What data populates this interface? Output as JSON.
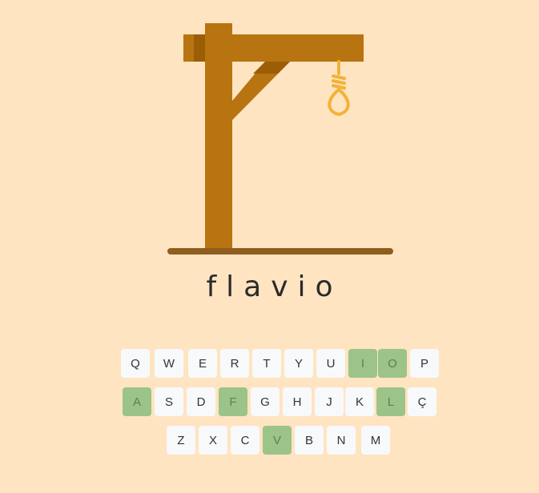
{
  "game": {
    "word": "flavio",
    "colors": {
      "background": "#ffe4c2",
      "wood": "#b87410",
      "wood_dark": "#9b5e06",
      "ground": "#8f5d1e",
      "rope": "#f3b237",
      "key_used": "#9cc388",
      "key_default": "#f8f9fa"
    }
  },
  "keyboard": {
    "rows": [
      [
        {
          "label": "Q",
          "used": false
        },
        {
          "label": "W",
          "used": false
        },
        {
          "label": "E",
          "used": false
        },
        {
          "label": "R",
          "used": false
        },
        {
          "label": "T",
          "used": false
        },
        {
          "label": "Y",
          "used": false
        },
        {
          "label": "U",
          "used": false
        },
        {
          "label": "I",
          "used": true
        },
        {
          "label": "O",
          "used": true
        },
        {
          "label": "P",
          "used": false
        }
      ],
      [
        {
          "label": "A",
          "used": true
        },
        {
          "label": "S",
          "used": false
        },
        {
          "label": "D",
          "used": false
        },
        {
          "label": "F",
          "used": true
        },
        {
          "label": "G",
          "used": false
        },
        {
          "label": "H",
          "used": false
        },
        {
          "label": "J",
          "used": false
        },
        {
          "label": "K",
          "used": false
        },
        {
          "label": "L",
          "used": true
        },
        {
          "label": "Ç",
          "used": false
        }
      ],
      [
        {
          "label": "Z",
          "used": false
        },
        {
          "label": "X",
          "used": false
        },
        {
          "label": "C",
          "used": false
        },
        {
          "label": "V",
          "used": true
        },
        {
          "label": "B",
          "used": false
        },
        {
          "label": "N",
          "used": false
        },
        {
          "label": "M",
          "used": false
        }
      ]
    ]
  }
}
